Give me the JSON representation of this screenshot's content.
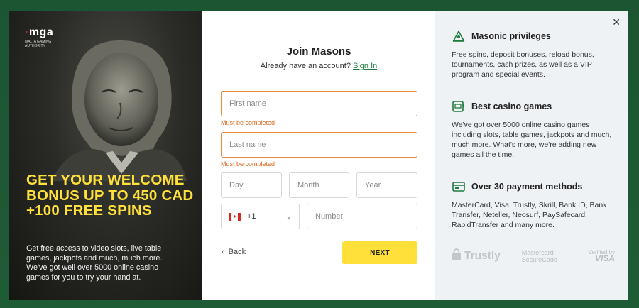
{
  "promo": {
    "mga_logo": "mga",
    "mga_subtitle": "MALTA GAMING AUTHORITY",
    "headline": "GET YOUR WELCOME BONUS UP TO 450 CAD +100 FREE SPINS",
    "description": "Get free access to video slots, live table games, jackpots and much, much more. We've got well over 5000 online casino games for you to try your hand at."
  },
  "form": {
    "title": "Join Masons",
    "have_account": "Already have an account?",
    "sign_in": "Sign In",
    "first_name_placeholder": "First name",
    "first_name_error": "Must be completed",
    "last_name_placeholder": "Last name",
    "last_name_error": "Must be completed",
    "day_placeholder": "Day",
    "month_placeholder": "Month",
    "year_placeholder": "Year",
    "phone_code": "+1",
    "phone_placeholder": "Number",
    "back_label": "Back",
    "next_label": "NEXT"
  },
  "info": {
    "features": [
      {
        "icon": "crown-icon",
        "title": "Masonic privileges",
        "text": "Free spins, deposit bonuses, reload bonus, tournaments, cash prizes, as well as a VIP program and special events."
      },
      {
        "icon": "slot-machine-icon",
        "title": "Best casino games",
        "text": "We've got over 5000 online casino games including slots, table games, jackpots and much, much more. What's more, we're adding new games all the time."
      },
      {
        "icon": "card-payment-icon",
        "title": "Over 30 payment methods",
        "text": "MasterCard, Visa, Trustly, Skrill, Bank ID, Bank Transfer, Neteller, Neosurf, PaySafecard, RapidTransfer and many more."
      }
    ],
    "logos": {
      "trustly": "Trustly",
      "mastercard": "Mastercard SecureCode",
      "visa_top": "Verified by",
      "visa_bottom": "VISA"
    }
  },
  "colors": {
    "accent_yellow": "#ffe03a",
    "error_orange": "#e06a20",
    "link_green": "#1e7a3f",
    "page_green": "#1f5a35"
  }
}
